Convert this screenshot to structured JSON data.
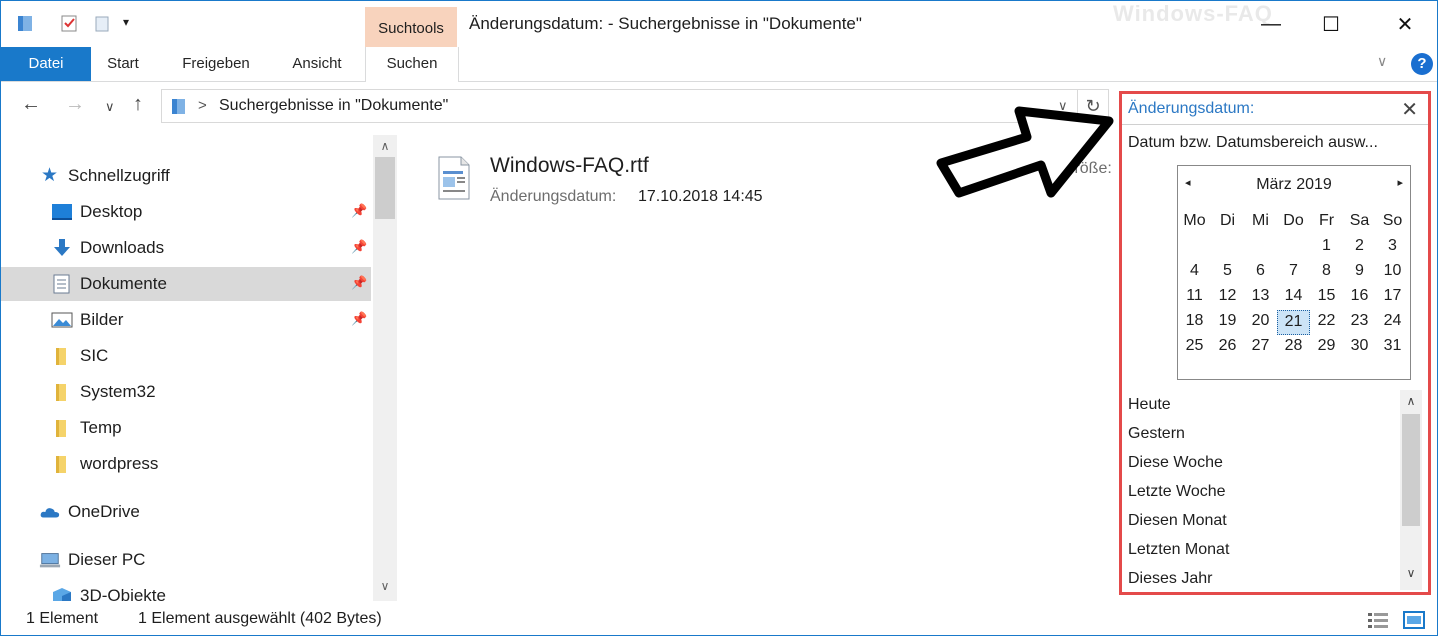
{
  "window": {
    "title": "Änderungsdatum: - Suchergebnisse in \"Dokumente\"",
    "watermark": "Windows-FAQ",
    "context_tab": "Suchtools",
    "minimize_glyph": "—",
    "maximize_glyph": "☐",
    "close_glyph": "✕"
  },
  "ribbon": {
    "tabs": [
      "Datei",
      "Start",
      "Freigeben",
      "Ansicht",
      "Suchen"
    ],
    "help_label": "?",
    "collapse_glyph": "∨"
  },
  "address": {
    "back_glyph": "←",
    "forward_glyph": "→",
    "recent_glyph": "∨",
    "up_glyph": "↑",
    "separator": ">",
    "path": "Suchergebnisse in \"Dokumente\"",
    "dropdown_glyph": "∨",
    "refresh_glyph": "↻"
  },
  "nav": {
    "items": [
      {
        "label": "Schnellzugriff",
        "icon": "star-icon"
      },
      {
        "label": "Desktop",
        "icon": "desktop-icon",
        "pinned": true
      },
      {
        "label": "Downloads",
        "icon": "download-icon",
        "pinned": true
      },
      {
        "label": "Dokumente",
        "icon": "documents-icon",
        "pinned": true,
        "selected": true
      },
      {
        "label": "Bilder",
        "icon": "pictures-icon",
        "pinned": true
      },
      {
        "label": "SIC",
        "icon": "folder-icon"
      },
      {
        "label": "System32",
        "icon": "folder-icon"
      },
      {
        "label": "Temp",
        "icon": "folder-icon"
      },
      {
        "label": "wordpress",
        "icon": "folder-icon"
      },
      {
        "label": "OneDrive",
        "icon": "cloud-icon"
      },
      {
        "label": "Dieser PC",
        "icon": "computer-icon"
      },
      {
        "label": "3D-Objekte",
        "icon": "3d-objects-icon"
      }
    ],
    "pin_glyph": "📌",
    "scroll_up": "∧",
    "scroll_down": "∨"
  },
  "content": {
    "file_name": "Windows-FAQ.rtf",
    "meta_label": "Änderungsdatum:",
    "meta_value": "17.10.2018 14:45",
    "size_label": "Größe:"
  },
  "date_panel": {
    "title": "Änderungsdatum:",
    "close_glyph": "✕",
    "subtitle": "Datum bzw. Datumsbereich ausw...",
    "calendar": {
      "month": "März 2019",
      "prev": "◂",
      "next": "▸",
      "weekdays": [
        "Mo",
        "Di",
        "Mi",
        "Do",
        "Fr",
        "Sa",
        "So"
      ],
      "weeks": [
        [
          "",
          "",
          "",
          "",
          "1",
          "2",
          "3"
        ],
        [
          "4",
          "5",
          "6",
          "7",
          "8",
          "9",
          "10"
        ],
        [
          "11",
          "12",
          "13",
          "14",
          "15",
          "16",
          "17"
        ],
        [
          "18",
          "19",
          "20",
          "21",
          "22",
          "23",
          "24"
        ],
        [
          "25",
          "26",
          "27",
          "28",
          "29",
          "30",
          "31"
        ]
      ],
      "selected_day": "21"
    },
    "quick_options": [
      "Heute",
      "Gestern",
      "Diese Woche",
      "Letzte Woche",
      "Diesen Monat",
      "Letzten Monat",
      "Dieses Jahr"
    ],
    "scroll_up": "∧",
    "scroll_down": "∨"
  },
  "status": {
    "count": "1 Element",
    "selection": "1 Element ausgewählt (402 Bytes)"
  },
  "colors": {
    "accent": "#1979ca",
    "context_tab": "#f8d3bd",
    "panel_border": "#e44a4a",
    "panel_title": "#2b78c4"
  }
}
